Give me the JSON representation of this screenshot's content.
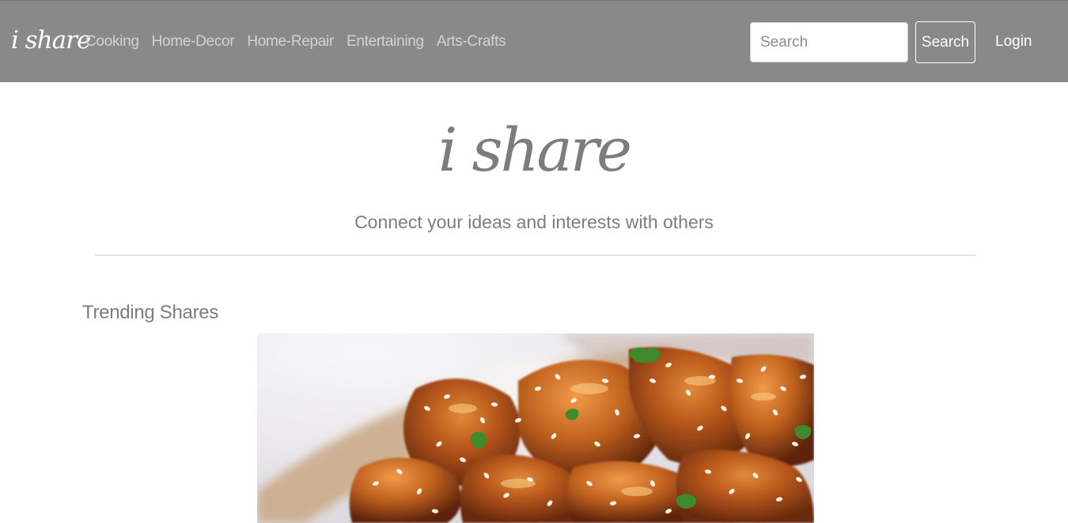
{
  "navbar": {
    "brand": "i share",
    "links": [
      "Cooking",
      "Home-Decor",
      "Home-Repair",
      "Entertaining",
      "Arts-Crafts"
    ],
    "search_placeholder": "Search",
    "search_button": "Search",
    "login": "Login"
  },
  "hero": {
    "title": "i share",
    "tagline": "Connect your ideas and interests with others"
  },
  "trending": {
    "heading": "Trending Shares",
    "items": [
      {
        "image_icon": "food-photo-icon"
      }
    ]
  },
  "colors": {
    "navbar_bg": "#878a88",
    "text_muted": "#7b7e7c",
    "nav_link": "#d2d4d2"
  }
}
